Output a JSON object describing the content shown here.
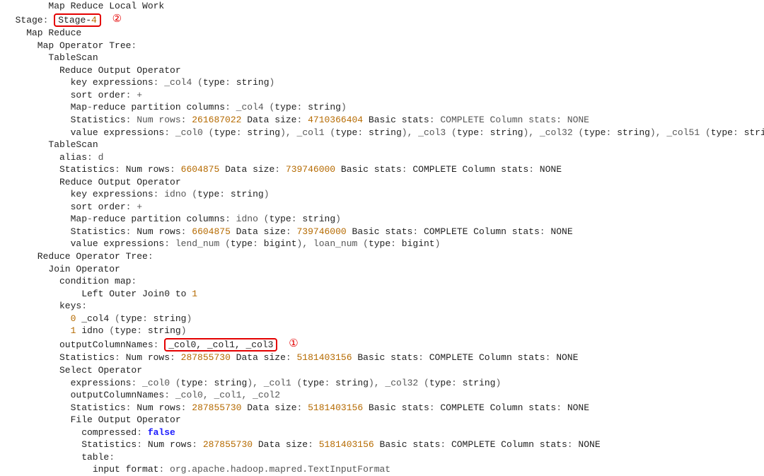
{
  "annotations": {
    "highlight1_text": "_col0, _col1, _col3",
    "highlight1_label": "①",
    "highlight2_text": "Stage-",
    "highlight2_num": "4",
    "highlight2_label": "②"
  },
  "plan": {
    "l01": "Map Reduce Local Work",
    "l02a": "Stage",
    "l02b": ":",
    "l03": "Map Reduce",
    "l04": "Map Operator Tree",
    "l05": "TableScan",
    "l06": "Reduce Output Operator",
    "l07a": "key expressions",
    "l07b": ": _col4 ",
    "l07c": "(",
    "l07d": "type",
    "l07e": ":",
    "l07f": " string",
    "l07g": ")",
    "l08a": "sort order",
    "l08b": ": +",
    "l09a": "Map",
    "l09b": "-reduce partition columns",
    "l09c": ": _col4 ",
    "l10a": "Statistics",
    "l10b": ": Num rows",
    "l10c": ": ",
    "l10n1": "261687022",
    "l10d": " Data size",
    "l10n2": "4710366404",
    "l10e": " Basic stats",
    "l10f": ": COMPLETE Column stats",
    "l10g": ": NONE",
    "l11a": "value expressions",
    "l11b": ": _col0 ",
    "l11c": "(",
    "l11d": "type",
    "l11e": ": string",
    "l11f": "), _col1 ",
    "l11g": "), _col3 ",
    "l11h": "), _col32 ",
    "l11i": "), _col51 ",
    "l11j": ")",
    "l12": "TableScan",
    "l13a": "alias",
    "l13b": ": d",
    "l14n1": "6604875",
    "l14n2": "739746000",
    "l15": "Reduce Output Operator",
    "l16b": ": idno ",
    "l17a": "Map",
    "l17b": "-reduce partition columns",
    "l17c": ": idno ",
    "l19a": "value expressions",
    "l19b": ": lend_num ",
    "l19c": " bigint",
    "l19d": "), loan_num ",
    "l20": "Reduce Operator Tree",
    "l21": "Join Operator",
    "l22": "condition map",
    "l23a": "Left Outer Join0 to ",
    "l23n": "1",
    "l24": "keys",
    "l25n": "0",
    "l25a": " _col4 ",
    "l26n": "1",
    "l26a": " idno ",
    "l27a": "outputColumnNames",
    "l27b": ":",
    "l28n1": "287855730",
    "l28n2": "5181403156",
    "l29": "Select Operator",
    "l30a": "expressions",
    "l30b": ": _col0 ",
    "l30c": "), _col1 ",
    "l30d": "), _col32 ",
    "l31a": "outputColumnNames",
    "l31b": ": _col0, _col1, _col2",
    "l33": "File Output Operator",
    "l34a": "compressed",
    "l34b": ": ",
    "l34c": "false",
    "l36": "table",
    "l37a": "input format",
    "l37b": ": org",
    "l37c": ".apache",
    "l37d": ".hadoop",
    "l37e": ".mapred",
    "l37f": ".TextInputFormat"
  }
}
